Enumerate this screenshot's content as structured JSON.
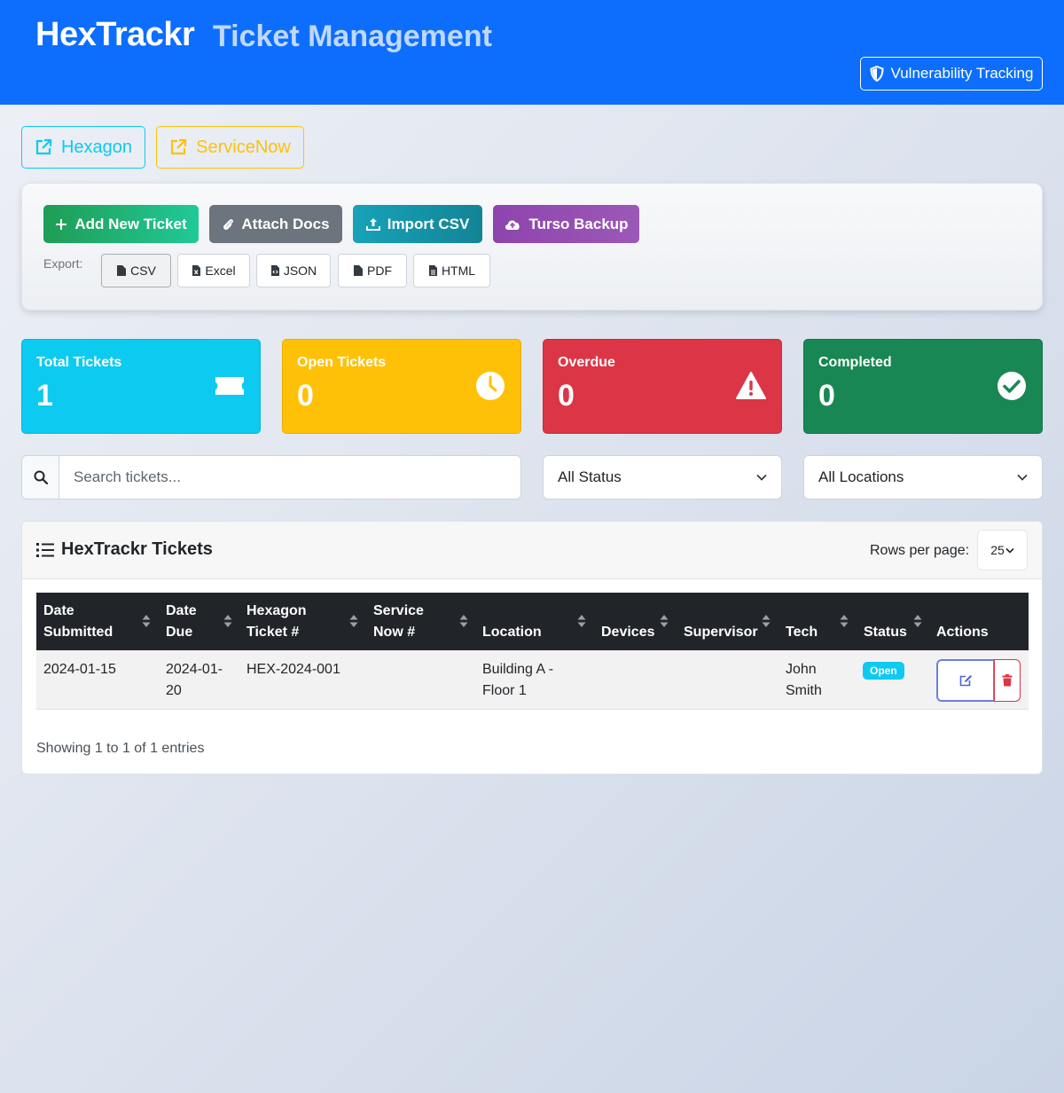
{
  "header": {
    "brand": "HexTrackr",
    "subtitle": "Ticket Management",
    "vuln_button": "Vulnerability Tracking"
  },
  "external_links": {
    "hexagon": "Hexagon",
    "servicenow": "ServiceNow"
  },
  "toolbar": {
    "add_ticket": "Add New Ticket",
    "attach_docs": "Attach Docs",
    "import_csv": "Import CSV",
    "turso_backup": "Turso Backup",
    "export_label": "Export:",
    "export_buttons": [
      "CSV",
      "Excel",
      "JSON",
      "PDF",
      "HTML"
    ]
  },
  "stats": [
    {
      "label": "Total Tickets",
      "value": "1",
      "icon": "ticket-icon",
      "color": "#0dcaf0"
    },
    {
      "label": "Open Tickets",
      "value": "0",
      "icon": "clock-icon",
      "color": "#ffc107"
    },
    {
      "label": "Overdue",
      "value": "0",
      "icon": "warning-icon",
      "color": "#dc3545"
    },
    {
      "label": "Completed",
      "value": "0",
      "icon": "check-circle-icon",
      "color": "#198754"
    }
  ],
  "filters": {
    "search_placeholder": "Search tickets...",
    "status_selected": "All Status",
    "location_selected": "All Locations"
  },
  "table": {
    "title": "HexTrackr Tickets",
    "rows_per_page_label": "Rows per page:",
    "rows_per_page_value": "25",
    "columns": [
      {
        "line1": "Date",
        "line2": "Submitted"
      },
      {
        "line1": "Date",
        "line2": "Due"
      },
      {
        "line1": "Hexagon",
        "line2": "Ticket #"
      },
      {
        "line1": "Service",
        "line2": "Now #"
      },
      {
        "line1": "",
        "line2": "Location"
      },
      {
        "line1": "",
        "line2": "Devices"
      },
      {
        "line1": "",
        "line2": "Supervisor"
      },
      {
        "line1": "",
        "line2": "Tech"
      },
      {
        "line1": "",
        "line2": "Status"
      },
      {
        "line1": "",
        "line2": "Actions"
      }
    ],
    "rows": [
      {
        "date_submitted": "2024-01-15",
        "date_due_1": "2024-01-",
        "date_due_2": "20",
        "hexagon_ticket": "HEX-2024-001",
        "servicenow": "",
        "location_1": "Building A -",
        "location_2": "Floor 1",
        "devices": "",
        "supervisor": "",
        "tech_1": "John",
        "tech_2": "Smith",
        "status": "Open"
      }
    ],
    "showing": "Showing 1 to 1 of 1 entries"
  },
  "colors": {
    "primary": "#0d6efd",
    "info": "#0dcaf0",
    "warning": "#ffc107",
    "danger": "#dc3545",
    "success": "#198754",
    "dark": "#212529"
  }
}
